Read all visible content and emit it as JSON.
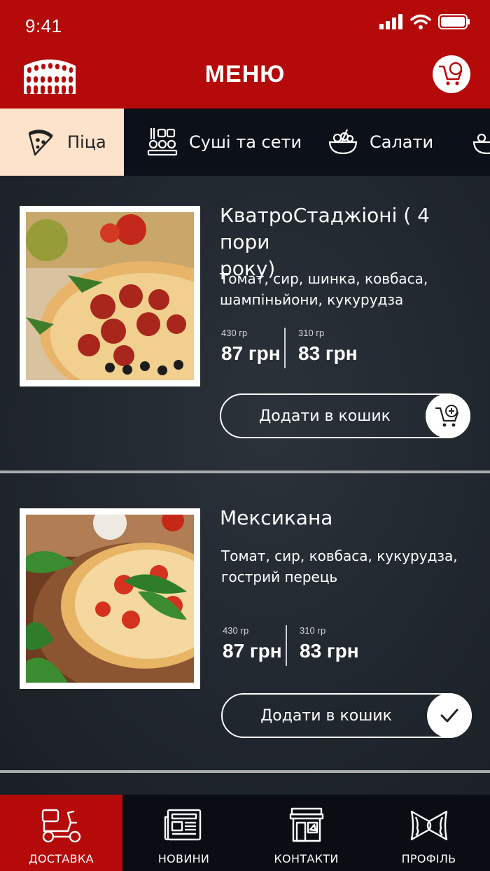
{
  "status": {
    "time": "9:41"
  },
  "header": {
    "title": "МЕНЮ",
    "logo_icon": "colosseum-icon",
    "cart_icon": "cart-icon"
  },
  "tabs": [
    {
      "label": "Піца",
      "icon": "pizza-slice-icon",
      "active": true
    },
    {
      "label": "Суші та сети",
      "icon": "sushi-icon",
      "active": false
    },
    {
      "label": "Салати",
      "icon": "salad-bowl-icon",
      "active": false
    }
  ],
  "items": [
    {
      "name_line1": "КватроСтаджіоні ( 4 пори",
      "name_line2": "року)",
      "desc_line1": "Томат, сир, шинка, ковбаса,",
      "desc_line2": "шампіньйони, кукурудза",
      "sizes": [
        {
          "weight": "430 гр",
          "price": "87 грн"
        },
        {
          "weight": "310 гр",
          "price": "83 грн"
        }
      ],
      "button_label": "Додати в кошик",
      "button_icon": "add-to-cart-icon"
    },
    {
      "name_line1": "Мексикана",
      "desc_line1": "Томат, сир,  ковбаса, кукурудза,",
      "desc_line2": "гострий перець",
      "sizes": [
        {
          "weight": "430 гр",
          "price": "87 грн"
        },
        {
          "weight": "310 гр",
          "price": "83 грн"
        }
      ],
      "button_label": "Додати в кошик",
      "button_icon": "check-icon"
    }
  ],
  "bottom_nav": [
    {
      "label": "ДОСТАВКА",
      "icon": "scooter-icon",
      "active": true
    },
    {
      "label": "НОВИНИ",
      "icon": "newspaper-icon",
      "active": false
    },
    {
      "label": "КОНТАКТИ",
      "icon": "storefront-icon",
      "active": false
    },
    {
      "label": "ПРОФІЛЬ",
      "icon": "pasta-bow-icon",
      "active": false
    }
  ],
  "colors": {
    "brand_red": "#b50a0a",
    "active_tab": "#fde3cb",
    "dark_bar": "#0c1018"
  }
}
